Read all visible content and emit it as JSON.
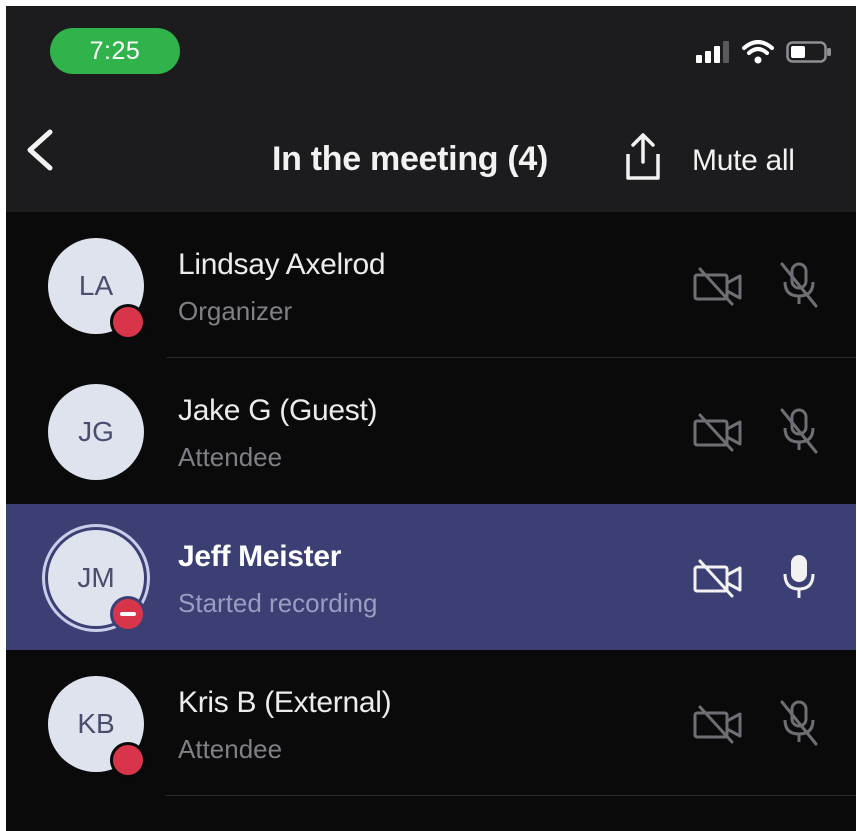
{
  "status_bar": {
    "time": "7:25",
    "signal_icon": "cellular-signal-icon",
    "wifi_icon": "wifi-icon",
    "battery_icon": "battery-icon",
    "time_pill_color": "#2fb34a"
  },
  "header": {
    "back_icon": "chevron-left-icon",
    "title": "In the meeting (4)",
    "share_icon": "share-icon",
    "mute_all_label": "Mute all"
  },
  "participants": [
    {
      "initials": "LA",
      "name": "Lindsay Axelrod",
      "role": "Organizer",
      "presence": "busy",
      "camera": "off",
      "mic": "muted",
      "active": false
    },
    {
      "initials": "JG",
      "name": "Jake G (Guest)",
      "role": "Attendee",
      "presence": "none",
      "camera": "off",
      "mic": "muted",
      "active": false
    },
    {
      "initials": "JM",
      "name": "Jeff Meister",
      "role": "Started recording",
      "presence": "do-not-disturb",
      "camera": "off",
      "mic": "on",
      "active": true
    },
    {
      "initials": "KB",
      "name": "Kris B (External)",
      "role": "Attendee",
      "presence": "busy",
      "camera": "off",
      "mic": "muted",
      "active": false
    }
  ],
  "colors": {
    "background": "#0a0a0b",
    "header_background": "#1c1c1e",
    "active_row": "#3b3f74",
    "presence_busy": "#d9354a",
    "avatar_bg": "#dfe3ee"
  }
}
